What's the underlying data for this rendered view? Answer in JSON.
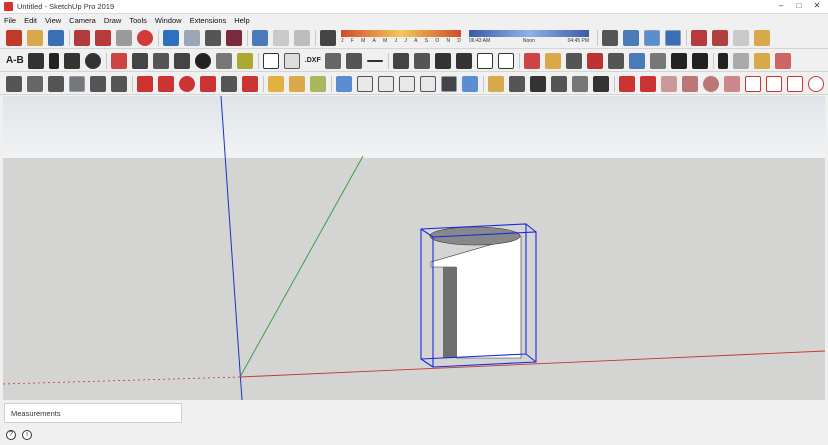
{
  "window": {
    "title": "Untitled - SketchUp Pro 2019",
    "controls": [
      "–",
      "□",
      "✕"
    ]
  },
  "menu": [
    "File",
    "Edit",
    "View",
    "Camera",
    "Draw",
    "Tools",
    "Window",
    "Extensions",
    "Help"
  ],
  "toolbar": {
    "text_tool_label": "A-B",
    "dxf_label": ".DXF",
    "shadow_months": [
      "J",
      "F",
      "M",
      "A",
      "M",
      "J",
      "J",
      "A",
      "S",
      "O",
      "N",
      "D"
    ],
    "time_start": "06:43 AM",
    "time_noon": "Noon",
    "time_end": "04:45 PM"
  },
  "status": {
    "measurements_label": "Measurements",
    "info_icon": "?",
    "user_icon": "i"
  },
  "colors": {
    "red_axis": "#c0392b",
    "green_axis": "#2f9a3f",
    "blue_axis": "#2030c0",
    "selection": "#1a2adf"
  }
}
